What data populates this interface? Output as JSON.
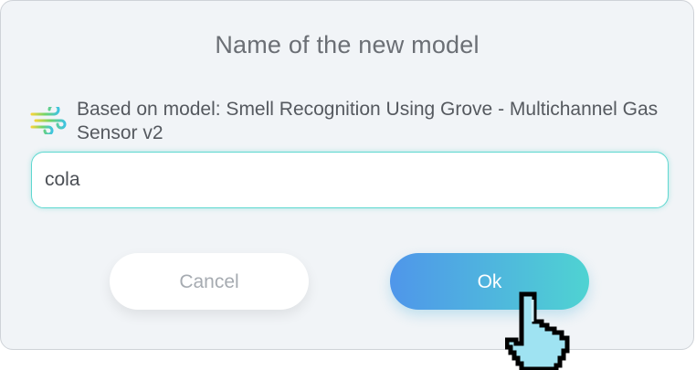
{
  "dialog": {
    "title": "Name of the new model",
    "model_info": "Based on model: Smell Recognition Using Grove - Multichannel Gas Sensor v2",
    "model_icon": "wind-icon",
    "name_input": {
      "value": "cola",
      "placeholder": ""
    },
    "buttons": {
      "cancel_label": "Cancel",
      "ok_label": "Ok"
    }
  },
  "colors": {
    "ok_gradient_start": "#4f96ea",
    "ok_gradient_end": "#4fd3d2",
    "input_border": "#5fd8d0",
    "dialog_bg": "#f1f4f7"
  },
  "cursor": {
    "icon": "hand-pointer-icon"
  }
}
